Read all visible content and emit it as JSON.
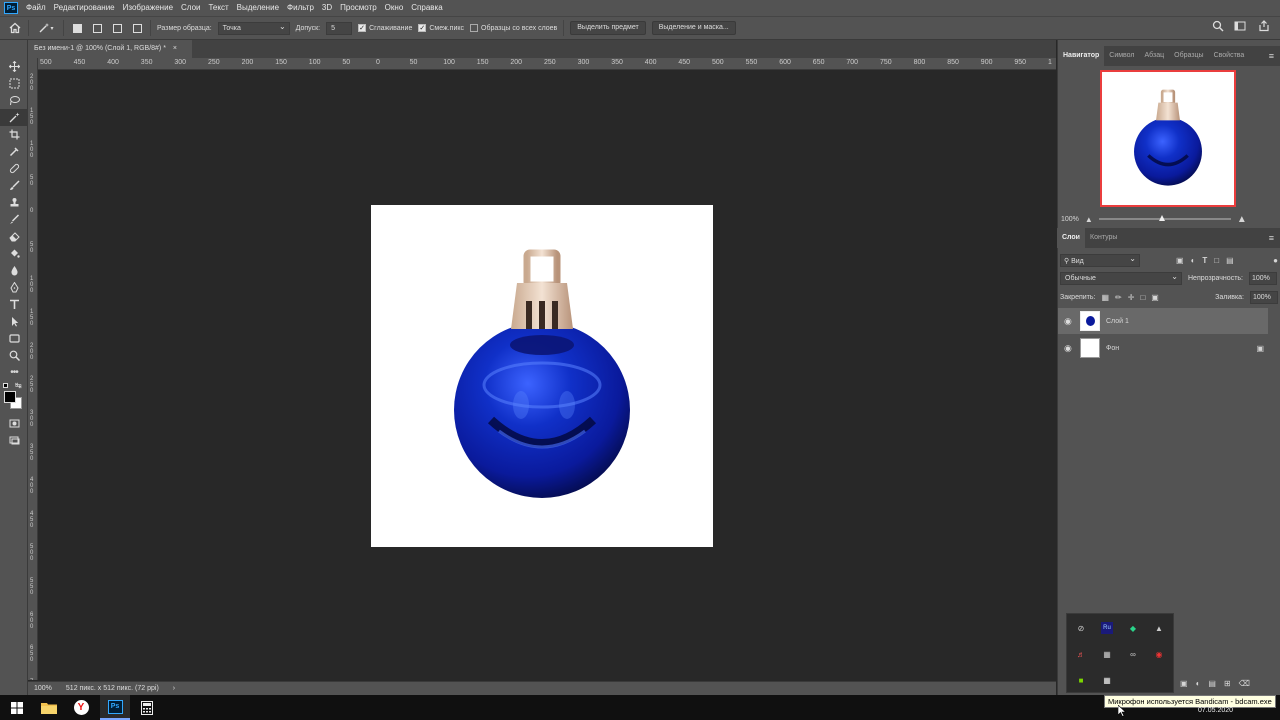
{
  "app": {
    "logo": "Ps"
  },
  "menu": [
    "Файл",
    "Редактирование",
    "Изображение",
    "Слои",
    "Текст",
    "Выделение",
    "Фильтр",
    "3D",
    "Просмотр",
    "Окно",
    "Справка"
  ],
  "options": {
    "sample_size_label": "Размер образца:",
    "sample_size_value": "Точка",
    "tolerance_label": "Допуск:",
    "tolerance_value": "5",
    "antialias_label": "Сглаживание",
    "contiguous_label": "Смеж.пикс",
    "all_layers_label": "Образцы со всех слоев",
    "select_subject_label": "Выделить предмет",
    "select_mask_label": "Выделение и маска..."
  },
  "document": {
    "tab_title": "Без имени-1 @ 100% (Слой 1, RGB/8#) *",
    "zoom": "100%",
    "size_info": "512 пикс. x 512 пикс. (72 ppi)"
  },
  "ruler": {
    "h_labels": [
      "500",
      "450",
      "400",
      "350",
      "300",
      "250",
      "200",
      "150",
      "100",
      "50",
      "0",
      "50",
      "100",
      "150",
      "200",
      "250",
      "300",
      "350",
      "400",
      "450",
      "500",
      "550",
      "600",
      "650",
      "700",
      "750",
      "800",
      "850",
      "900",
      "950",
      "1"
    ],
    "v_labels": [
      "200",
      "150",
      "100",
      "50",
      "0",
      "50",
      "100",
      "150",
      "200",
      "250",
      "300",
      "350",
      "400",
      "450",
      "500",
      "550",
      "600",
      "650",
      "7"
    ]
  },
  "panels": {
    "nav_tabs": [
      "Навигатор",
      "Символ",
      "Абзац",
      "Образцы",
      "Свойства"
    ],
    "nav_zoom": "100%",
    "layers_tabs": [
      "Слои",
      "Контуры"
    ],
    "filter_value": "Вид",
    "blend_mode": "Обычные",
    "opacity_label": "Непрозрачность:",
    "opacity_value": "100%",
    "lock_label": "Закрепить:",
    "fill_label": "Заливка:",
    "fill_value": "100%",
    "layers": [
      {
        "name": "Слой 1"
      },
      {
        "name": "Фон"
      }
    ]
  },
  "tray": {
    "tooltip": "Микрофон используется Bandicam - bdcam.exe",
    "date": "07.05.2020"
  },
  "colors": {
    "accent": "#31a8ff",
    "ornament": "#0a1a9c",
    "cap": "#d8bfa8"
  }
}
